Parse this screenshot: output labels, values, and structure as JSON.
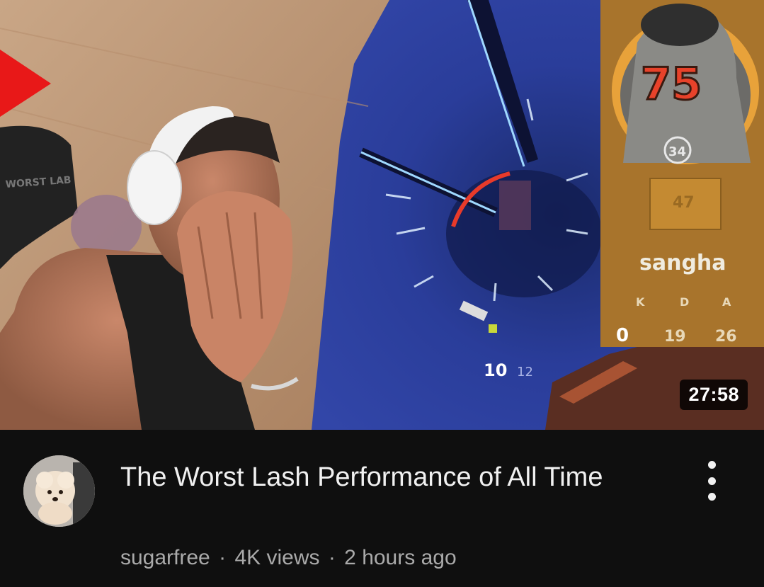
{
  "video": {
    "duration": "27:58",
    "title": "The Worst Lash Performance of All Time",
    "channel": "sugarfree",
    "views": "4K views",
    "age": "2 hours ago",
    "separator": "·"
  },
  "thumbnail_hud": {
    "hero_level": "75",
    "rank": "34",
    "score": "47",
    "player_name": "sangha",
    "kda_labels": [
      "K",
      "D",
      "A"
    ],
    "kda_values": [
      "0",
      "19",
      "26"
    ],
    "ammo": "10",
    "ammo_max": "12",
    "chair_text": "WORST LAB"
  },
  "icons": {
    "menu": "more-vert-icon",
    "avatar": "channel-avatar"
  },
  "colors": {
    "background": "#0f0f0f",
    "title": "#f1f1f1",
    "meta": "#aaaaaa",
    "hud_panel": "#b07a2a",
    "level_red": "#e8422a"
  }
}
